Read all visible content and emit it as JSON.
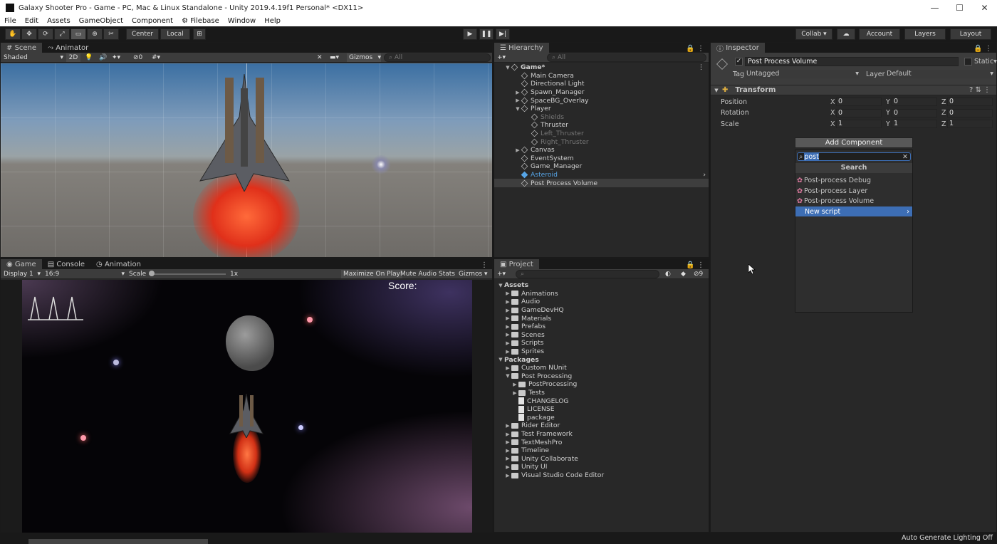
{
  "window": {
    "title": "Galaxy Shooter Pro - Game - PC, Mac & Linux Standalone - Unity 2019.4.19f1 Personal* <DX11>",
    "controls": [
      "—",
      "☐",
      "✕"
    ]
  },
  "menu": [
    "File",
    "Edit",
    "Assets",
    "GameObject",
    "Component",
    "⚙ Filebase",
    "Window",
    "Help"
  ],
  "toolbar": {
    "pivot": "Center",
    "space": "Local",
    "collab": "Collab ▾",
    "account": "Account",
    "layers": "Layers",
    "layout": "Layout"
  },
  "scene": {
    "tabs": [
      "Scene",
      "Animator"
    ],
    "shading": "Shaded",
    "mode2d": "2D",
    "hidden_count": "0",
    "gizmos": "Gizmos",
    "search_placeholder": "All"
  },
  "game": {
    "tabs": [
      "Game",
      "Console",
      "Animation"
    ],
    "display": "Display 1",
    "aspect": "16:9",
    "scale_label": "Scale",
    "scale_value": "1x",
    "maximize": "Maximize On Play",
    "mute": "Mute Audio",
    "stats": "Stats",
    "gizmos": "Gizmos",
    "score": "Score:"
  },
  "hierarchy": {
    "tab": "Hierarchy",
    "search_placeholder": "All",
    "items": [
      {
        "label": "Game*",
        "indent": 0,
        "kind": "scene",
        "open": true
      },
      {
        "label": "Main Camera",
        "indent": 1
      },
      {
        "label": "Directional Light",
        "indent": 1
      },
      {
        "label": "Spawn_Manager",
        "indent": 1,
        "collapsed": true
      },
      {
        "label": "SpaceBG_Overlay",
        "indent": 1,
        "collapsed": true
      },
      {
        "label": "Player",
        "indent": 1,
        "open": true
      },
      {
        "label": "Shields",
        "indent": 2,
        "dim": true
      },
      {
        "label": "Thruster",
        "indent": 2
      },
      {
        "label": "Left_Thruster",
        "indent": 2,
        "dim": true
      },
      {
        "label": "Right_Thruster",
        "indent": 2,
        "dim": true
      },
      {
        "label": "Canvas",
        "indent": 1,
        "collapsed": true
      },
      {
        "label": "EventSystem",
        "indent": 1
      },
      {
        "label": "Game_Manager",
        "indent": 1
      },
      {
        "label": "Asteroid",
        "indent": 1,
        "prefab": true
      },
      {
        "label": "Post Process Volume",
        "indent": 1,
        "selected": true
      }
    ]
  },
  "project": {
    "tab": "Project",
    "hidden_count": "9",
    "items": [
      {
        "label": "Assets",
        "indent": 0,
        "open": true,
        "bold": true
      },
      {
        "label": "Animations",
        "indent": 1,
        "type": "folder"
      },
      {
        "label": "Audio",
        "indent": 1,
        "type": "folder"
      },
      {
        "label": "GameDevHQ",
        "indent": 1,
        "type": "folder"
      },
      {
        "label": "Materials",
        "indent": 1,
        "type": "folder"
      },
      {
        "label": "Prefabs",
        "indent": 1,
        "type": "folder"
      },
      {
        "label": "Scenes",
        "indent": 1,
        "type": "folder"
      },
      {
        "label": "Scripts",
        "indent": 1,
        "type": "folder"
      },
      {
        "label": "Sprites",
        "indent": 1,
        "type": "folder"
      },
      {
        "label": "Packages",
        "indent": 0,
        "open": true,
        "bold": true
      },
      {
        "label": "Custom NUnit",
        "indent": 1,
        "type": "folder"
      },
      {
        "label": "Post Processing",
        "indent": 1,
        "type": "folder",
        "open": true
      },
      {
        "label": "PostProcessing",
        "indent": 2,
        "type": "folder"
      },
      {
        "label": "Tests",
        "indent": 2,
        "type": "folder"
      },
      {
        "label": "CHANGELOG",
        "indent": 2,
        "type": "file"
      },
      {
        "label": "LICENSE",
        "indent": 2,
        "type": "file"
      },
      {
        "label": "package",
        "indent": 2,
        "type": "file"
      },
      {
        "label": "Rider Editor",
        "indent": 1,
        "type": "folder"
      },
      {
        "label": "Test Framework",
        "indent": 1,
        "type": "folder"
      },
      {
        "label": "TextMeshPro",
        "indent": 1,
        "type": "folder"
      },
      {
        "label": "Timeline",
        "indent": 1,
        "type": "folder"
      },
      {
        "label": "Unity Collaborate",
        "indent": 1,
        "type": "folder"
      },
      {
        "label": "Unity UI",
        "indent": 1,
        "type": "folder"
      },
      {
        "label": "Visual Studio Code Editor",
        "indent": 1,
        "type": "folder"
      }
    ]
  },
  "inspector": {
    "tab": "Inspector",
    "object_name": "Post Process Volume",
    "static_label": "Static",
    "tag_label": "Tag",
    "tag_value": "Untagged",
    "layer_label": "Layer",
    "layer_value": "Default",
    "transform_title": "Transform",
    "rows": [
      {
        "label": "Position",
        "x": "0",
        "y": "0",
        "z": "0"
      },
      {
        "label": "Rotation",
        "x": "0",
        "y": "0",
        "z": "0"
      },
      {
        "label": "Scale",
        "x": "1",
        "y": "1",
        "z": "1"
      }
    ],
    "axis": [
      "X",
      "Y",
      "Z"
    ],
    "add_component": "Add Component",
    "search_value": "post",
    "search_header": "Search",
    "results": [
      "Post-process Debug",
      "Post-process Layer",
      "Post-process Volume"
    ],
    "new_script": "New script"
  },
  "status": {
    "text": "Auto Generate Lighting Off"
  },
  "colors": {
    "accent": "#3d6eb5",
    "prefab": "#56a4e6",
    "selection": "#3e3e3e"
  }
}
